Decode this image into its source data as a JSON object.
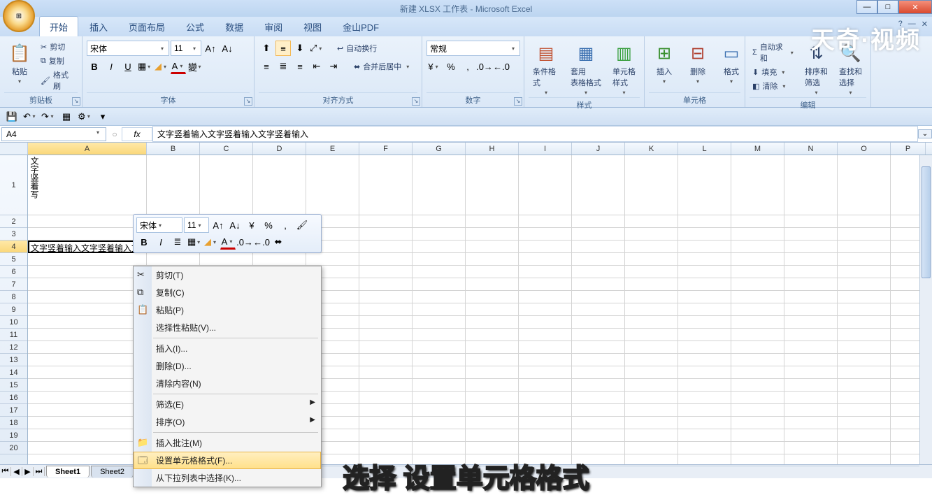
{
  "window": {
    "title": "新建 XLSX 工作表 - Microsoft Excel"
  },
  "tabs": {
    "t0": "开始",
    "t1": "插入",
    "t2": "页面布局",
    "t3": "公式",
    "t4": "数据",
    "t5": "审阅",
    "t6": "视图",
    "t7": "金山PDF"
  },
  "ribbon": {
    "clipboard": {
      "label": "剪贴板",
      "paste": "粘贴",
      "cut": "剪切",
      "copy": "复制",
      "painter": "格式刷"
    },
    "font": {
      "label": "字体",
      "name": "宋体",
      "size": "11"
    },
    "align": {
      "label": "对齐方式",
      "wrap": "自动换行",
      "merge": "合并后居中"
    },
    "number": {
      "label": "数字",
      "format": "常规"
    },
    "styles": {
      "label": "样式",
      "cond": "条件格式",
      "table": "套用\n表格格式",
      "cell": "单元格\n样式"
    },
    "cells": {
      "label": "单元格",
      "insert": "插入",
      "delete": "删除",
      "format": "格式"
    },
    "editing": {
      "label": "编辑",
      "fill": "填充",
      "clear": "清除",
      "sort": "排序和\n筛选",
      "find": "查找和\n选择"
    }
  },
  "formula": {
    "cellref": "A4",
    "fx": "fx",
    "value": "文字竖着输入文字竖着输入文字竖着输入"
  },
  "columns": [
    "A",
    "B",
    "C",
    "D",
    "E",
    "F",
    "G",
    "H",
    "I",
    "J",
    "K",
    "L",
    "M",
    "N",
    "O",
    "P"
  ],
  "rows": [
    "1",
    "2",
    "3",
    "4",
    "5",
    "6",
    "7",
    "8",
    "9",
    "10",
    "11",
    "12",
    "13",
    "14",
    "15",
    "16",
    "17",
    "18",
    "19",
    "20"
  ],
  "cell_a1": "文字竖着写",
  "cell_a4": "文字竖着输入文字竖着输入文字竖着输入",
  "mini": {
    "font": "宋体",
    "size": "11"
  },
  "ctx": {
    "cut": "剪切(T)",
    "copy": "复制(C)",
    "paste": "粘贴(P)",
    "pastespecial": "选择性粘贴(V)...",
    "insert": "插入(I)...",
    "delete": "删除(D)...",
    "clear": "清除内容(N)",
    "filter": "筛选(E)",
    "sort": "排序(O)",
    "comment": "插入批注(M)",
    "formatcells": "设置单元格格式(F)...",
    "pickfromlist": "从下拉列表中选择(K)..."
  },
  "sheets": {
    "s1": "Sheet1",
    "s2": "Sheet2"
  },
  "watermark": "天奇·视频",
  "subtitle": "选择 设置单元格格式"
}
